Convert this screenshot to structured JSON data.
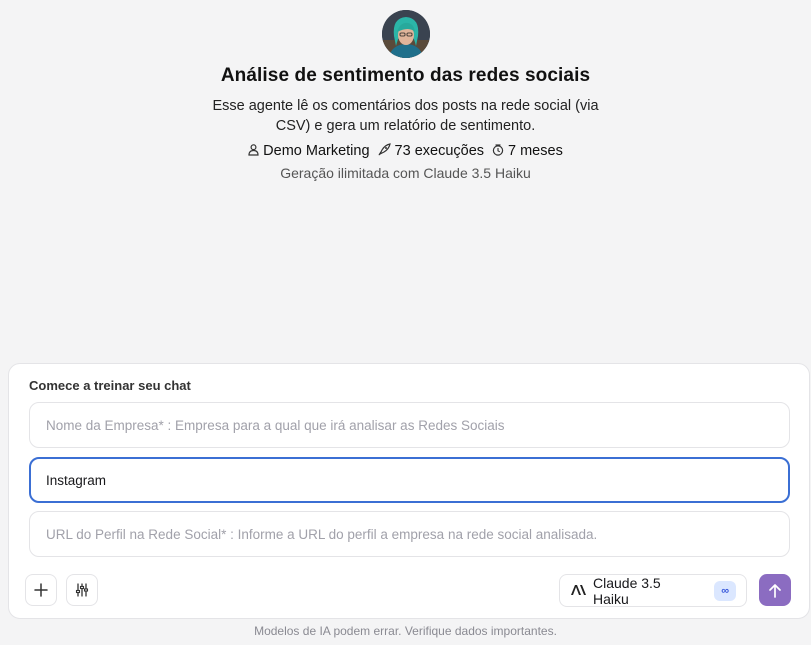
{
  "agent": {
    "title": "Análise de sentimento das redes sociais",
    "description": "Esse agente lê os comentários dos posts na rede social (via CSV) e gera um relatório de sentimento.",
    "author": "Demo Marketing",
    "executions": "73 execuções",
    "age": "7 meses",
    "subtitle": "Geração ilimitada com Claude 3.5 Haiku",
    "icons": {
      "author": "user-icon",
      "executions": "rocket-icon",
      "age": "clock-icon"
    }
  },
  "chat": {
    "title": "Comece a treinar seu chat",
    "fields": [
      {
        "placeholder": "Nome da Empresa* : Empresa para a qual que irá analisar as Redes Sociais",
        "value": ""
      },
      {
        "placeholder": "",
        "value": "Instagram"
      },
      {
        "placeholder": "URL do Perfil na Rede Social* : Informe a URL do perfil a empresa na rede social analisada.",
        "value": ""
      }
    ],
    "toolbar": {
      "add_icon": "plus-icon",
      "settings_icon": "sliders-icon",
      "model_label": "Claude 3.5 Haiku",
      "model_badge": "∞",
      "send_icon": "arrow-up-icon"
    }
  },
  "footer": {
    "note": "Modelos de IA podem errar. Verifique dados importantes."
  },
  "colors": {
    "background": "#f4f4f5",
    "focus_border": "#3b6fd4",
    "send_button": "#8b6cc1",
    "badge_bg": "#dbe7ff"
  }
}
